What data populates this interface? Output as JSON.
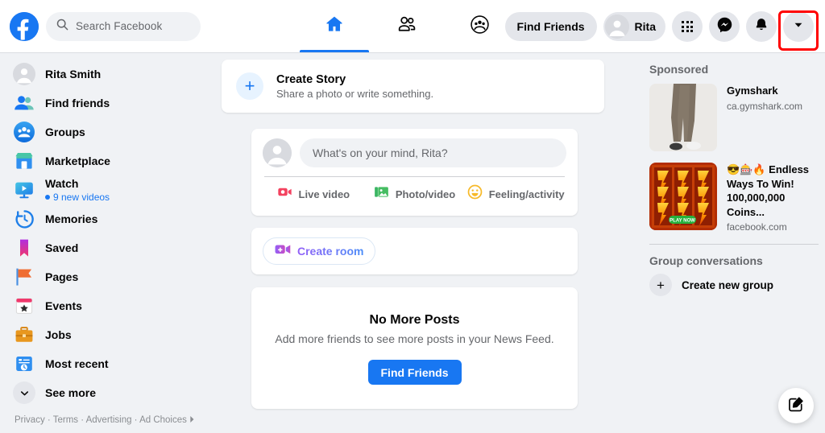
{
  "header": {
    "logo_name": "facebook-logo",
    "search": {
      "placeholder": "Search Facebook",
      "value": ""
    },
    "tabs": [
      {
        "name": "home",
        "icon": "home-icon",
        "active": true
      },
      {
        "name": "friends",
        "icon": "friends-icon",
        "active": false
      },
      {
        "name": "groups",
        "icon": "groups-icon",
        "active": false
      }
    ],
    "find_friends_label": "Find Friends",
    "account_name": "Rita",
    "menu_icon": "grid-menu-icon",
    "messenger_icon": "messenger-icon",
    "notifications_icon": "bell-icon",
    "account_dropdown_icon": "chevron-down-icon",
    "highlight_color": "#ff0000",
    "accent_color": "#1877f2"
  },
  "sidebar": {
    "items": [
      {
        "label": "Rita Smith",
        "icon": "user-avatar-icon",
        "sub": ""
      },
      {
        "label": "Find friends",
        "icon": "find-friends-icon",
        "sub": ""
      },
      {
        "label": "Groups",
        "icon": "groups-icon",
        "sub": ""
      },
      {
        "label": "Marketplace",
        "icon": "marketplace-icon",
        "sub": ""
      },
      {
        "label": "Watch",
        "icon": "watch-icon",
        "sub": "9 new videos"
      },
      {
        "label": "Memories",
        "icon": "memories-icon",
        "sub": ""
      },
      {
        "label": "Saved",
        "icon": "saved-icon",
        "sub": ""
      },
      {
        "label": "Pages",
        "icon": "pages-icon",
        "sub": ""
      },
      {
        "label": "Events",
        "icon": "events-icon",
        "sub": ""
      },
      {
        "label": "Jobs",
        "icon": "jobs-icon",
        "sub": ""
      },
      {
        "label": "Most recent",
        "icon": "most-recent-icon",
        "sub": ""
      },
      {
        "label": "See more",
        "icon": "chevron-down-icon",
        "sub": ""
      }
    ],
    "footer": "Privacy · Terms · Advertising · Ad Choices"
  },
  "feed": {
    "create_story": {
      "title": "Create Story",
      "subtitle": "Share a photo or write something.",
      "icon": "plus-icon"
    },
    "composer": {
      "placeholder": "What's on your mind, Rita?",
      "actions": [
        {
          "label": "Live video",
          "icon": "live-video-icon",
          "color": "#f3425f"
        },
        {
          "label": "Photo/video",
          "icon": "photo-video-icon",
          "color": "#45bd62"
        },
        {
          "label": "Feeling/activity",
          "icon": "feeling-activity-icon",
          "color": "#f7b928"
        }
      ]
    },
    "create_room": {
      "label": "Create room",
      "icon": "video-room-icon"
    },
    "no_more_posts": {
      "title": "No More Posts",
      "subtitle": "Add more friends to see more posts in your News Feed.",
      "button_label": "Find Friends"
    }
  },
  "rail": {
    "sponsored_heading": "Sponsored",
    "ads": [
      {
        "title": "Gymshark",
        "url": "ca.gymshark.com",
        "thumb": "gymshark-leggings-thumb"
      },
      {
        "title": "😎🎰🔥 Endless Ways To Win! 100,000,000 Coins...",
        "url": "facebook.com",
        "thumb": "slot-machine-thumb"
      }
    ],
    "group_conversations_heading": "Group conversations",
    "create_new_group_label": "Create new group",
    "create_new_group_icon": "plus-icon",
    "compose_fab_icon": "compose-pencil-icon"
  }
}
